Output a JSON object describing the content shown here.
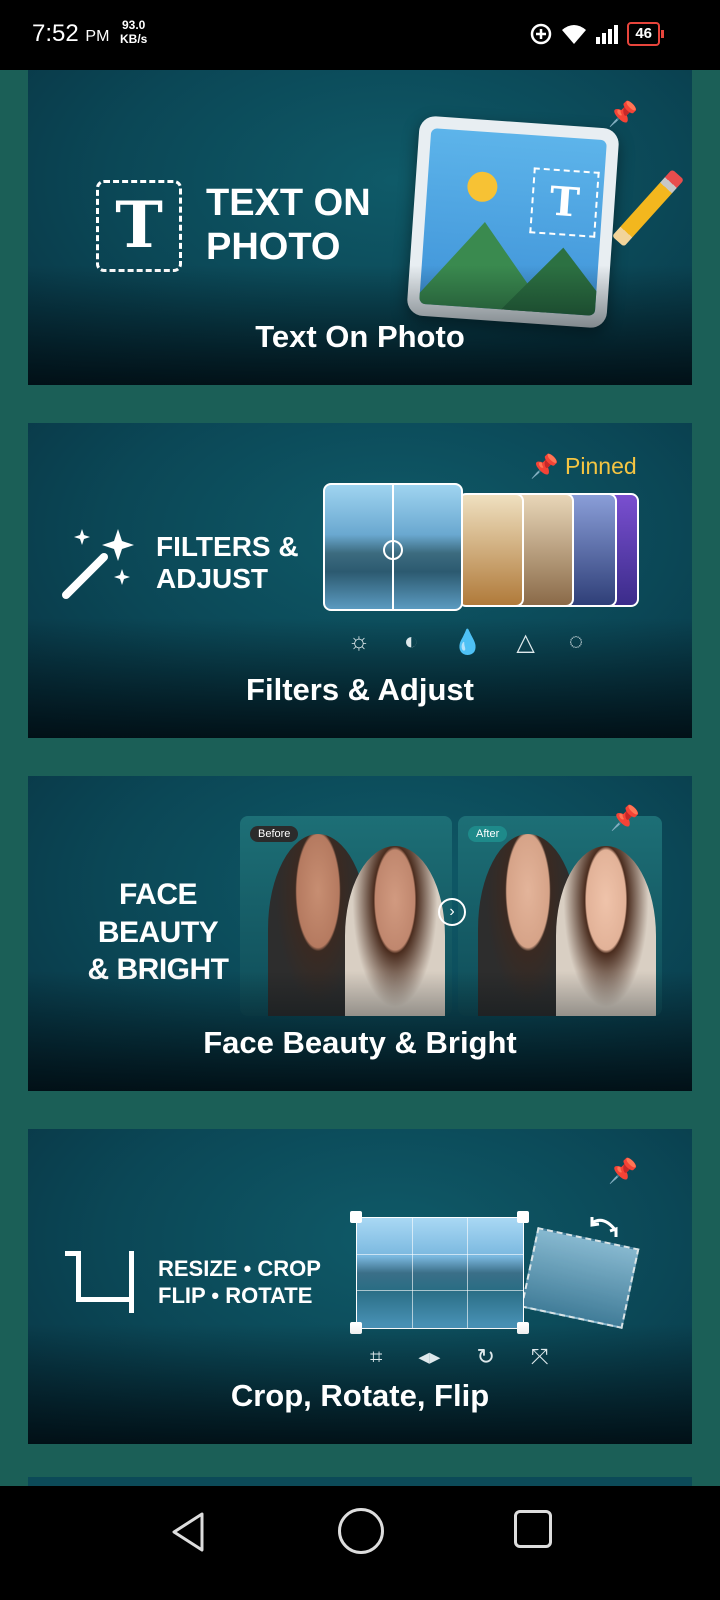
{
  "status_bar": {
    "time": "7:52",
    "ampm": "PM",
    "speed_value": "93.0",
    "speed_unit": "KB/s",
    "battery": "46"
  },
  "cards": [
    {
      "id": "text-on-photo",
      "headline_line1": "TEXT ON",
      "headline_line2": "PHOTO",
      "title": "Text On Photo",
      "icon_letter": "T",
      "pinned": true
    },
    {
      "id": "filters-adjust",
      "headline_line1": "FILTERS &",
      "headline_line2": "ADJUST",
      "title": "Filters & Adjust",
      "pinned_label": "Pinned",
      "adjust_icons": [
        "brightness-icon",
        "contrast-icon",
        "saturation-icon",
        "sharpen-icon",
        "vignette-icon"
      ]
    },
    {
      "id": "face-beauty",
      "headline_line1": "FACE BEAUTY",
      "headline_line2": "& BRIGHT",
      "title": "Face Beauty & Bright",
      "before_label": "Before",
      "after_label": "After",
      "pinned": true
    },
    {
      "id": "crop-rotate",
      "headline_line1": "RESIZE • CROP",
      "headline_line2": "FLIP • ROTATE",
      "title": "Crop, Rotate, Flip",
      "tool_icons": [
        "crop-icon",
        "flip-icon",
        "rotate-icon",
        "resize-icon"
      ],
      "pinned": true
    }
  ],
  "colors": {
    "page_bg": "#1b5f57",
    "card_bg": "#0b4756",
    "pinned_text": "#f5c542",
    "battery_border": "#e8453c"
  }
}
